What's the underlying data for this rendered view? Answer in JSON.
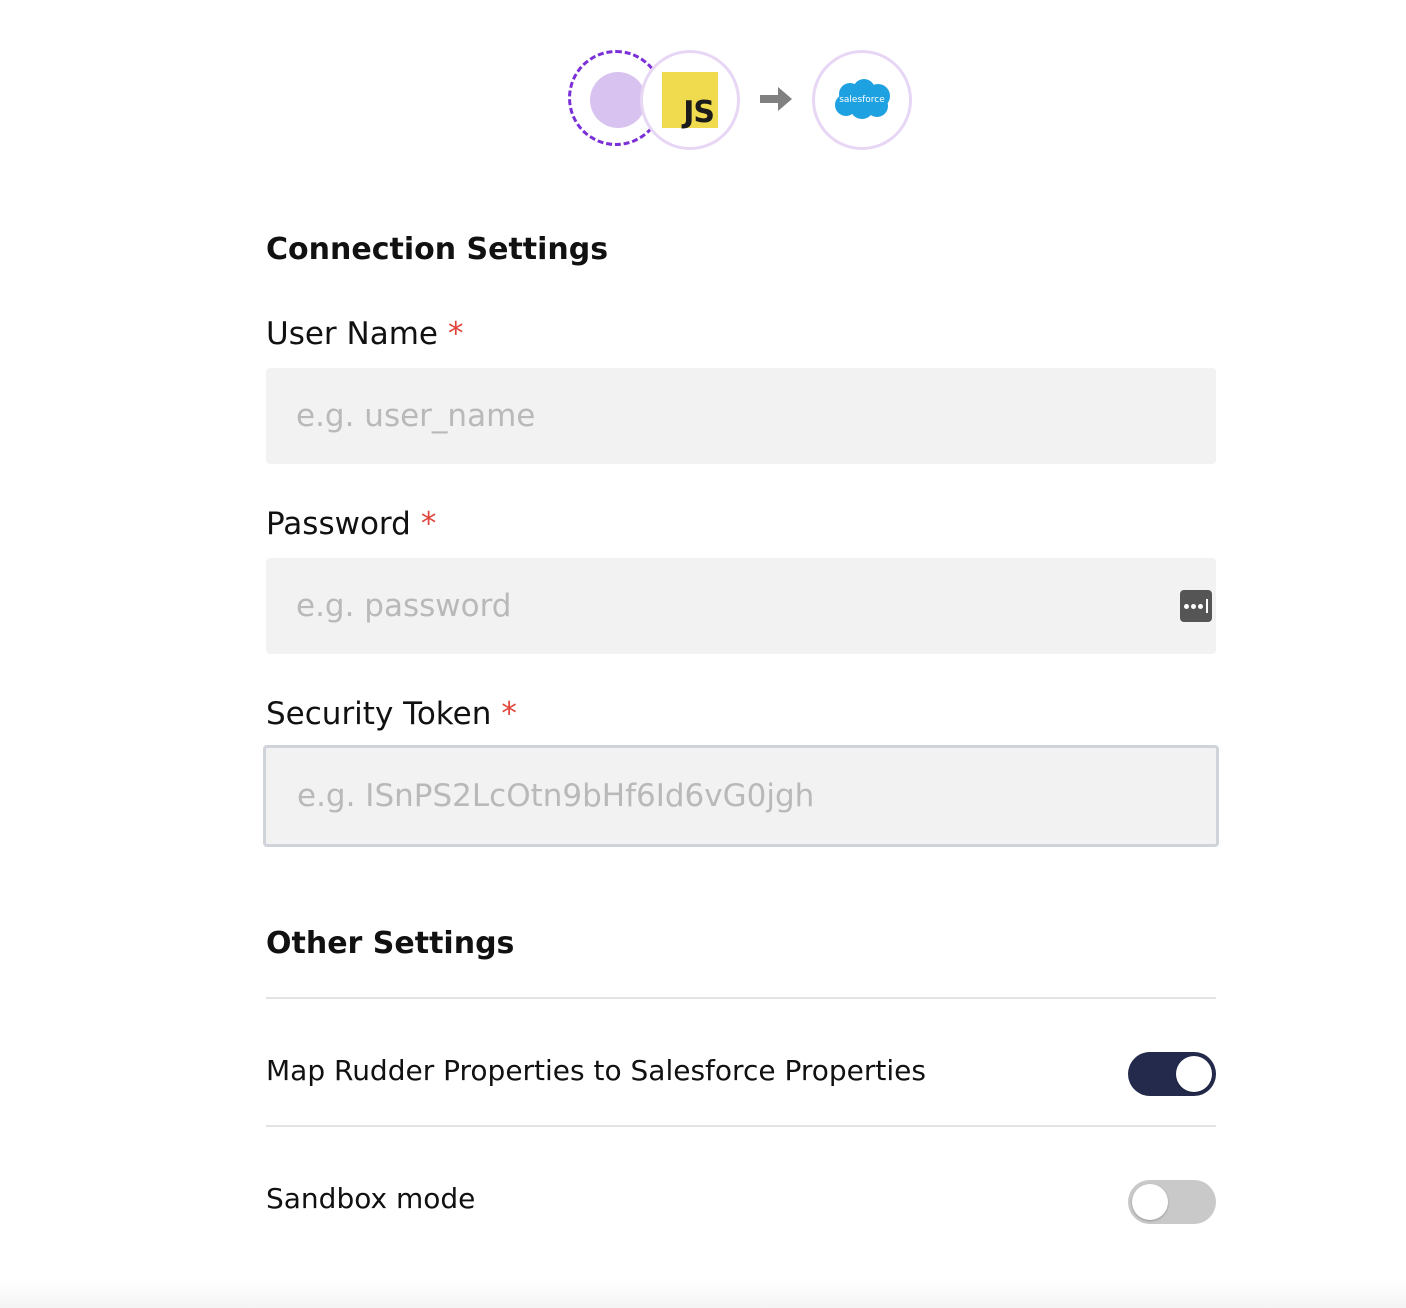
{
  "flow": {
    "source_icon": "javascript-logo-icon",
    "source_logo_text": "JS",
    "arrow_icon": "arrow-right-icon",
    "destination_icon": "salesforce-logo-icon",
    "destination_logo_text": "salesforce"
  },
  "connection_settings": {
    "title": "Connection Settings",
    "fields": [
      {
        "label": "User Name",
        "required_mark": "*",
        "placeholder": "e.g. user_name",
        "value": ""
      },
      {
        "label": "Password",
        "required_mark": "*",
        "placeholder": "e.g. password",
        "value": "",
        "trailing_icon": "password-manager-key-icon"
      },
      {
        "label": "Security Token",
        "required_mark": "*",
        "placeholder": "e.g. ISnPS2LcOtn9bHf6Id6vG0jgh",
        "value": ""
      }
    ]
  },
  "other_settings": {
    "title": "Other Settings",
    "toggles": [
      {
        "label": "Map Rudder Properties to Salesforce Properties",
        "enabled": true
      },
      {
        "label": "Sandbox mode",
        "enabled": false
      }
    ]
  },
  "colors": {
    "required": "#e0443b",
    "toggle_on": "#232a4b",
    "toggle_off": "#c9c9c9",
    "source_dashed_ring": "#7b2fd6",
    "js_yellow": "#f0db4f",
    "salesforce_blue": "#1ea1e0"
  }
}
